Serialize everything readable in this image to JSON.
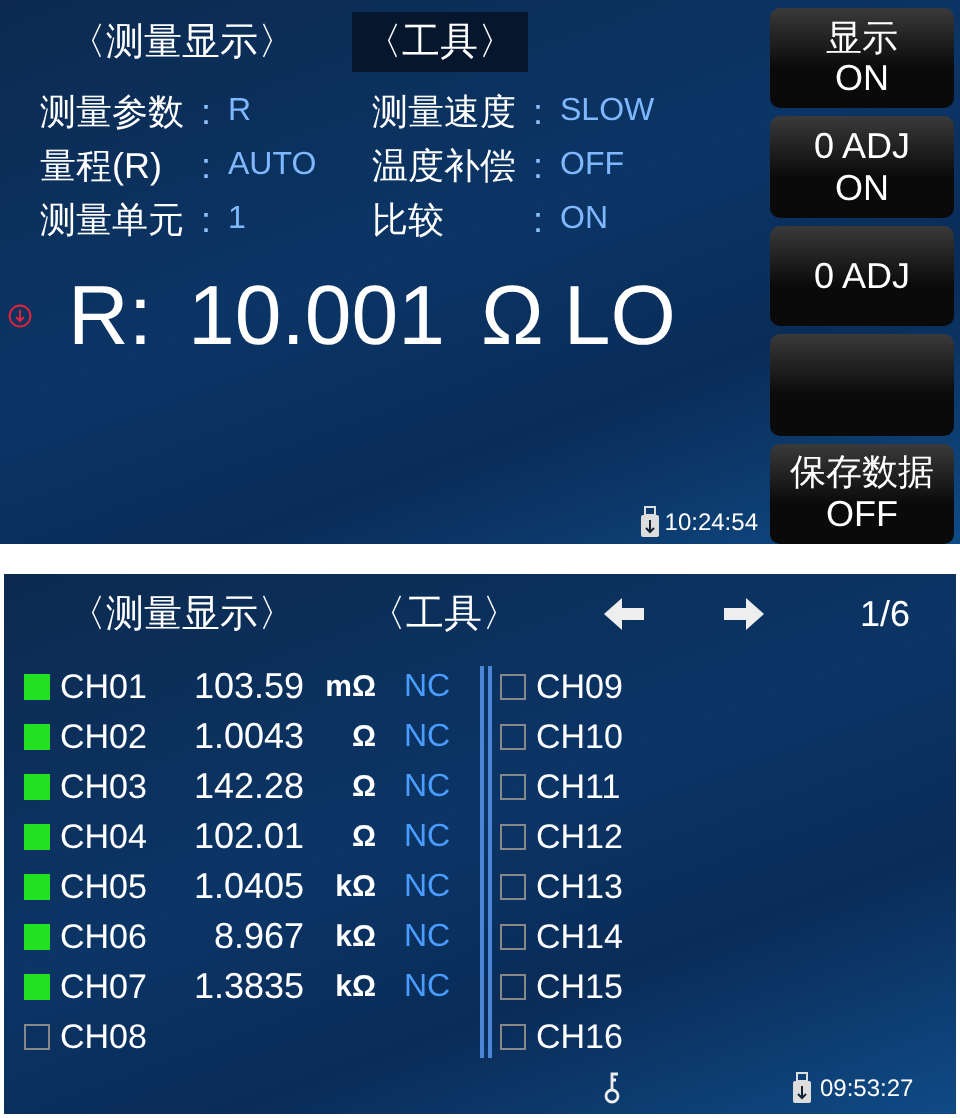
{
  "measure_screen": {
    "tabs": [
      {
        "label": "〈测量显示〉",
        "selected": false
      },
      {
        "label": "〈工具〉",
        "selected": true
      }
    ],
    "params": [
      {
        "label": "测量参数",
        "separator": ":",
        "value": "R"
      },
      {
        "label": "测量速度",
        "separator": ":",
        "value": "SLOW"
      },
      {
        "label": "量程(R)",
        "separator": ":",
        "value": "AUTO"
      },
      {
        "label": "温度补偿",
        "separator": ":",
        "value": "OFF"
      },
      {
        "label": "测量单元",
        "separator": ":",
        "value": "1"
      },
      {
        "label": "比较",
        "separator": ":",
        "value": "ON"
      }
    ],
    "reading": {
      "parameter": "R:",
      "value": "10.001",
      "unit": "Ω",
      "judgement": "LO"
    },
    "softkeys": [
      {
        "kind": "labeled",
        "lines": [
          "显示",
          "ON"
        ]
      },
      {
        "kind": "labeled",
        "lines": [
          "0 ADJ",
          "ON"
        ]
      },
      {
        "kind": "labeled",
        "lines": [
          "0 ADJ"
        ]
      },
      {
        "kind": "blank"
      },
      {
        "kind": "labeled",
        "lines": [
          "保存数据",
          "OFF"
        ]
      }
    ],
    "time": "10:24:54"
  },
  "channel_screen": {
    "tabs": [
      {
        "label": "〈测量显示〉",
        "selected": false
      },
      {
        "label": "〈工具〉",
        "selected": false
      }
    ],
    "page": "1/6",
    "columns": [
      [
        {
          "name": "CH01",
          "active": true,
          "value": "103.59",
          "unit": "mΩ",
          "result": "NC"
        },
        {
          "name": "CH02",
          "active": true,
          "value": "1.0043",
          "unit": "Ω",
          "result": "NC"
        },
        {
          "name": "CH03",
          "active": true,
          "value": "142.28",
          "unit": "Ω",
          "result": "NC"
        },
        {
          "name": "CH04",
          "active": true,
          "value": "102.01",
          "unit": "Ω",
          "result": "NC"
        },
        {
          "name": "CH05",
          "active": true,
          "value": "1.0405",
          "unit": "kΩ",
          "result": "NC"
        },
        {
          "name": "CH06",
          "active": true,
          "value": "8.967",
          "unit": "kΩ",
          "result": "NC"
        },
        {
          "name": "CH07",
          "active": true,
          "value": "1.3835",
          "unit": "kΩ",
          "result": "NC"
        },
        {
          "name": "CH08",
          "active": false
        }
      ],
      [
        {
          "name": "CH09",
          "active": false
        },
        {
          "name": "CH10",
          "active": false
        },
        {
          "name": "CH11",
          "active": false
        },
        {
          "name": "CH12",
          "active": false
        },
        {
          "name": "CH13",
          "active": false
        },
        {
          "name": "CH14",
          "active": false
        },
        {
          "name": "CH15",
          "active": false
        },
        {
          "name": "CH16",
          "active": false
        }
      ]
    ],
    "time": "09:53:27"
  }
}
